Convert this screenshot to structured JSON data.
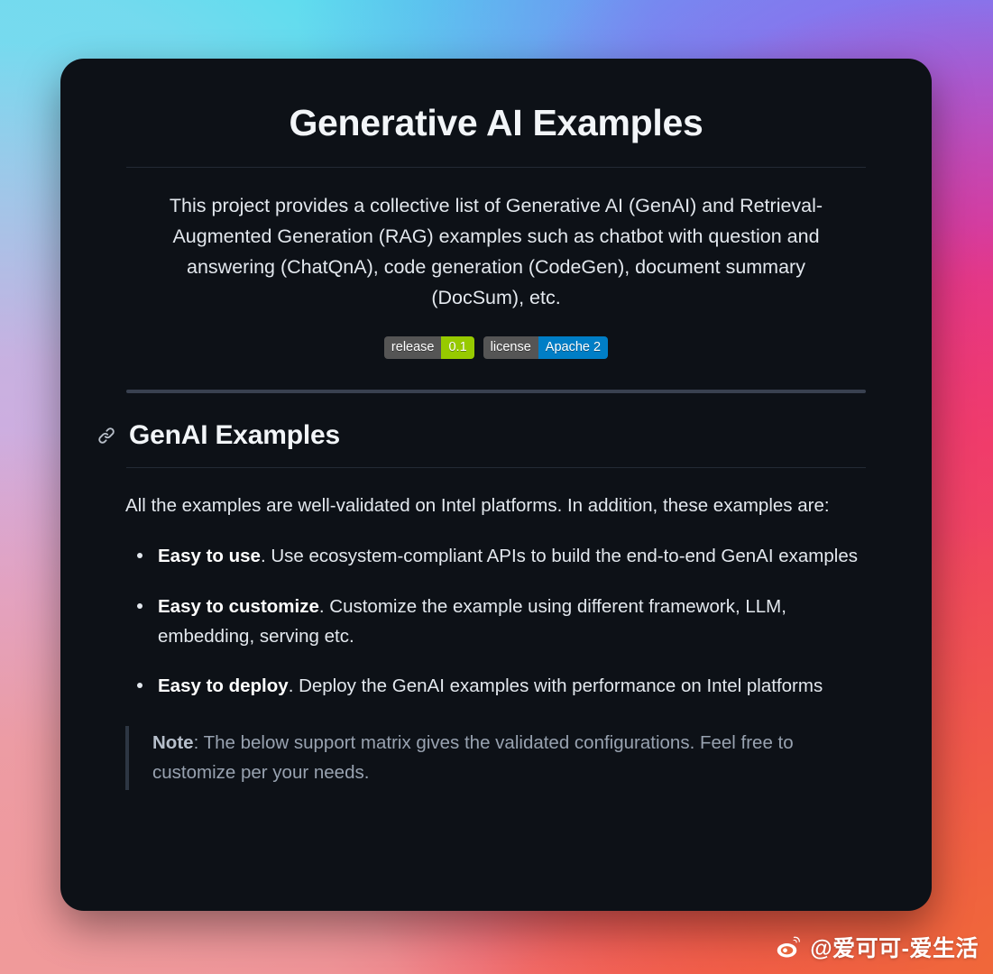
{
  "background": {
    "description": "multicolor gradient wallpaper",
    "colors": [
      "#2fe2ec",
      "#7fd9ef",
      "#6f8bf2",
      "#9c5ee8",
      "#d9a8dd",
      "#ef2d7e",
      "#f0475c",
      "#f09a9a",
      "#f4793c"
    ]
  },
  "card": {
    "background_color": "#0d1117",
    "title": "Generative AI Examples",
    "intro": "This project provides a collective list of Generative AI (GenAI) and Retrieval-Augmented Generation (RAG) examples such as chatbot with question and answering (ChatQnA), code generation (CodeGen), document summary (DocSum), etc.",
    "badges": [
      {
        "label": "release",
        "value": "0.1",
        "label_color": "#555555",
        "value_color": "#97ca00",
        "name": "release-badge"
      },
      {
        "label": "license",
        "value": "Apache 2",
        "label_color": "#555555",
        "value_color": "#007ec6",
        "name": "license-badge"
      }
    ],
    "section": {
      "anchor_icon": "link-icon",
      "heading": "GenAI Examples",
      "lead": "All the examples are well-validated on Intel platforms. In addition, these examples are:",
      "features": [
        {
          "bold": "Easy to use",
          "rest": ". Use ecosystem-compliant APIs to build the end-to-end GenAI examples"
        },
        {
          "bold": "Easy to customize",
          "rest": ". Customize the example using different framework, LLM, embedding, serving etc."
        },
        {
          "bold": "Easy to deploy",
          "rest": ". Deploy the GenAI examples with performance on Intel platforms"
        }
      ],
      "note": {
        "bold": "Note",
        "rest": ": The below support matrix gives the validated configurations. Feel free to customize per your needs."
      }
    }
  },
  "watermark": {
    "icon": "weibo-logo",
    "handle": "@爱可可-爱生活"
  }
}
